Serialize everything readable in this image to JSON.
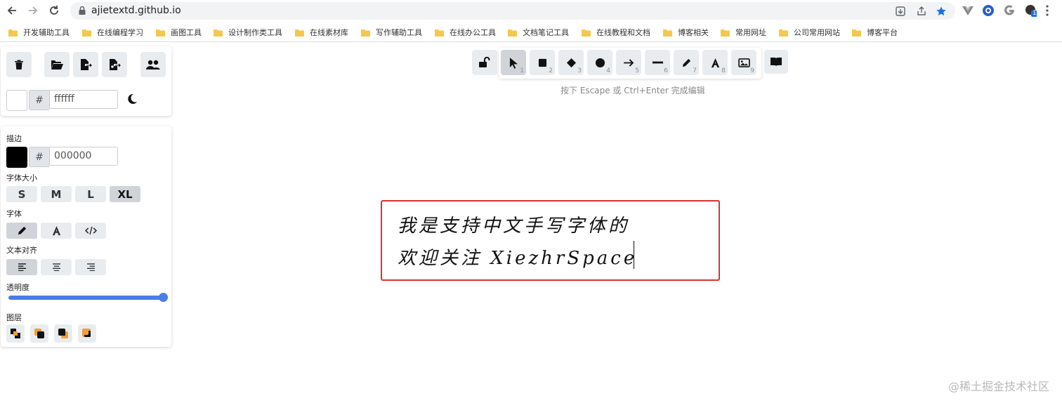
{
  "browser": {
    "url": "ajietextd.github.io"
  },
  "bookmarks": [
    "开发辅助工具",
    "在线编程学习",
    "画图工具",
    "设计制作类工具",
    "在线素材库",
    "写作辅助工具",
    "在线办公工具",
    "文档笔记工具",
    "在线教程和文档",
    "博客相关",
    "常用网址",
    "公司常用网站",
    "博客平台"
  ],
  "extension_badge": "1",
  "canvas_settings": {
    "background_hex": "ffffff",
    "hash": "#"
  },
  "properties": {
    "stroke_label": "描边",
    "stroke_hex": "000000",
    "hash": "#",
    "font_size_label": "字体大小",
    "font_sizes": [
      "S",
      "M",
      "L",
      "XL"
    ],
    "font_size_selected": "XL",
    "font_family_label": "字体",
    "align_label": "文本对齐",
    "opacity_label": "透明度",
    "opacity_value": 100,
    "layers_label": "图层",
    "accent_color": "#4a7de8"
  },
  "toolbar": {
    "shortcuts": [
      "1",
      "2",
      "3",
      "4",
      "5",
      "6",
      "7",
      "8",
      "9"
    ],
    "hint": "按下 Escape 或 Ctrl+Enter 完成编辑"
  },
  "canvas_text": {
    "line1": "我是支持中文手写字体的",
    "line2": "欢迎关注 XiezhrSpace",
    "border_color": "#e03030"
  },
  "watermark": "@稀土掘金技术社区"
}
